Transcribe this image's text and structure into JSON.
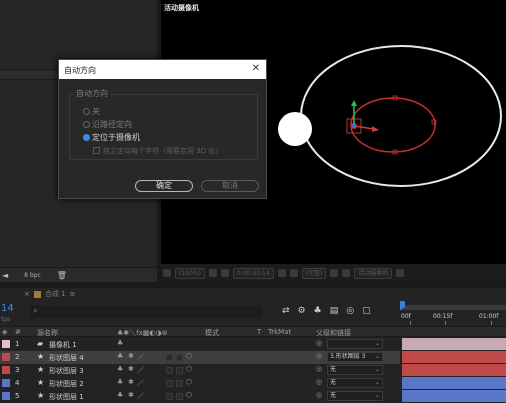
{
  "project_panel": {
    "bpc": "8 bpc"
  },
  "viewer": {
    "title": "活动摄像机",
    "toolbar": {
      "zoom": "(100%)",
      "timecode": "0:00:00:14",
      "resolution": "(完整)",
      "camera": "活动摄像机"
    }
  },
  "timeline": {
    "tab_label": "合成 1",
    "time": "14",
    "fps": "fps",
    "ruler": [
      "00f",
      "00:15f",
      "01:00f"
    ],
    "columns": {
      "number": "#",
      "source_name": "源名称",
      "mode": "模式",
      "t": "T",
      "trkmat": "TrkMat",
      "parent": "父级和链接"
    },
    "layers": [
      {
        "num": "1",
        "name": "摄像机 1",
        "type": "camera",
        "color": "#e5bfd0",
        "parent": ""
      },
      {
        "num": "2",
        "name": "形状图层 4",
        "type": "shape",
        "color": "#c04a4a",
        "parent": "3.形状图层 3"
      },
      {
        "num": "3",
        "name": "形状图层 3",
        "type": "shape",
        "color": "#c04a4a",
        "parent": "无"
      },
      {
        "num": "4",
        "name": "形状图层 2",
        "type": "shape",
        "color": "#5a76c9",
        "parent": "无"
      },
      {
        "num": "5",
        "name": "形状图层 1",
        "type": "shape",
        "color": "#5a76c9",
        "parent": "无"
      }
    ]
  },
  "dialog": {
    "title": "自动方向",
    "group_label": "自动方向",
    "options": [
      "关",
      "沿路径定向",
      "定位于摄像机"
    ],
    "selected_option": 2,
    "checkbox_label": "独立定向每个字符（需要启用 3D 化）",
    "ok_label": "确定",
    "cancel_label": "取消"
  },
  "colors": {
    "accent": "#2e83e6",
    "orbit_outer": "#ffffff",
    "orbit_inner": "#c53030"
  }
}
